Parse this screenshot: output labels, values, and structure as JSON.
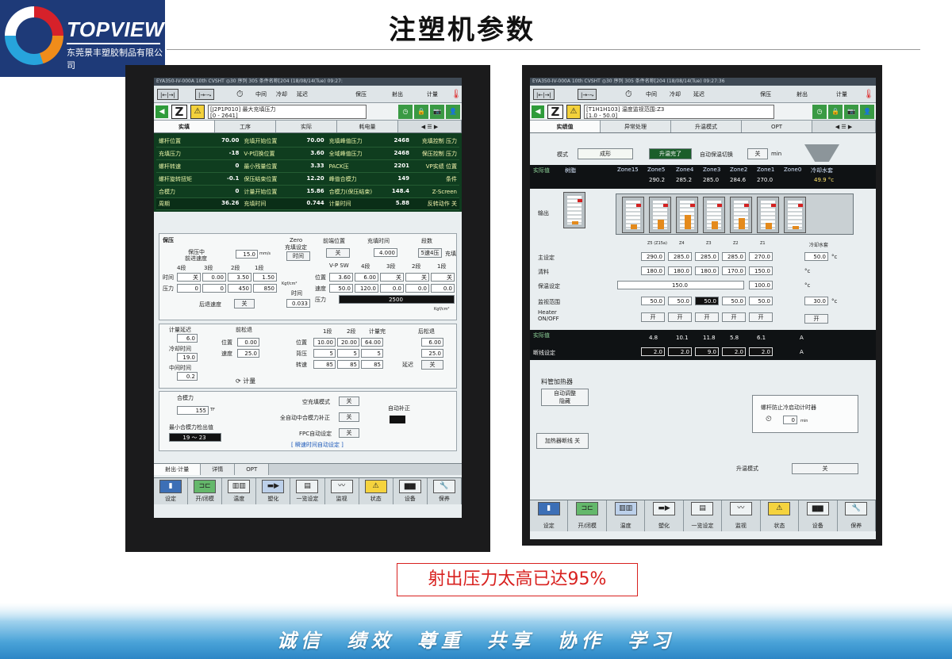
{
  "header": {
    "brand": "TOPVIEW",
    "company": "东莞景丰塑胶制品有限公司",
    "title": "注塑机参数"
  },
  "caption": "射出压力太高已达95%",
  "slogan": "诚信 绩效 尊重 共享 协作 学习",
  "left_screen": {
    "status": "EYA350-IV-000A 10th CVSHT  ◎30 序列 305 条件名称[204   (18/08/14(Tue)  09:27:",
    "top": {
      "inj_label": "射出",
      "hold_label": "保压",
      "meter_label": "计量",
      "stage1": "中间",
      "stage2": "冷却",
      "stage3": "延迟"
    },
    "param_code": "[J2P1P010] 最大充填压力",
    "param_range": "[0 - 2641]",
    "tabs": [
      "实填",
      "工序",
      "实际",
      "耗电量"
    ],
    "data_rows": [
      [
        [
          "螺杆位置",
          "70.00"
        ],
        [
          "充填开始位置",
          "70.00"
        ],
        [
          "充填峰值压力",
          "2468"
        ]
      ],
      [
        [
          "充填压力",
          "-18"
        ],
        [
          "V-P切换位置",
          "3.60"
        ],
        [
          "全域峰值压力",
          "2468"
        ]
      ],
      [
        [
          "螺杆转速",
          "0"
        ],
        [
          "最小残量位置",
          "3.33"
        ],
        [
          "PACK压",
          "2201"
        ]
      ],
      [
        [
          "螺杆旋转扭矩",
          "-0.1"
        ],
        [
          "保压结束位置",
          "12.20"
        ],
        [
          "峰值合模力",
          "149"
        ]
      ],
      [
        [
          "合模力",
          "0"
        ],
        [
          "计量开始位置",
          "15.86"
        ],
        [
          "合模力(保压结束)",
          "148.4"
        ]
      ]
    ],
    "side_labels": [
      [
        "压力",
        "充填控制"
      ],
      [
        "压力",
        "保压控制"
      ],
      [
        "位置",
        "VP实绩"
      ],
      [
        "条件",
        ""
      ],
      [
        "Z-Screen",
        ""
      ],
      [
        "反转动作",
        ""
      ]
    ],
    "summary": {
      "cycle_label": "周期",
      "cycle_val": "36.26",
      "fill_label": "充填时间",
      "fill_val": "0.744",
      "meter_label": "计量时间",
      "meter_val": "5.88",
      "side": "关"
    },
    "hold": {
      "title": "保压",
      "zero_label": "Zero",
      "zero_setting": "充填设定",
      "zero_btn": "时间",
      "speed_label": "保压中",
      "speed_sub": "前进速度",
      "speed_val": "15.0",
      "speed_unit": "mm/s",
      "stages": [
        "4段",
        "3段",
        "2段",
        "1段"
      ],
      "time_label": "时间",
      "time_vals": [
        "关",
        "0.00",
        "3.50",
        "1.50"
      ],
      "press_label": "压力",
      "press_vals": [
        "0",
        "0",
        "450",
        "850"
      ],
      "back_label": "后退速度",
      "back_val": "关",
      "time2_label": "时间",
      "time2_val": "0.033",
      "unit_kgf": "Kgf/cm²"
    },
    "fill": {
      "front_label": "前端位置",
      "front_val": "关",
      "filltime_label": "充填时间",
      "filltime_val": "4.000",
      "stage_label": "段数",
      "stage_val": "5速4压",
      "fill_label": "充填",
      "vp_label": "V-P SW",
      "stages": [
        "4段",
        "3段",
        "2段",
        "1段"
      ],
      "pos_label": "位置",
      "pos_vals": [
        "3.60",
        "6.00",
        "关",
        "关",
        "关"
      ],
      "speed_label": "速度",
      "speed_vals": [
        "50.0",
        "120.0",
        "0.0",
        "0.0",
        "0.0"
      ],
      "press_label": "压力",
      "press_val": "2500",
      "unit_kgf": "Kgf/cm²"
    },
    "meter": {
      "delay_label": "计量延迟",
      "delay_val": "6.0",
      "cool_label": "冷却时间",
      "cool_val": "19.0",
      "mid_label": "中间时间",
      "mid_val": "0.2",
      "pre_label": "前松退",
      "pos_label": "位置",
      "pos_val": "0.00",
      "spd_label": "速度",
      "spd_val": "25.0",
      "stages": [
        "1段",
        "2段",
        "计量完"
      ],
      "mpos_label": "位置",
      "mpos_vals": [
        "10.00",
        "20.00",
        "64.00"
      ],
      "back_label": "背压",
      "back_vals": [
        "5",
        "5",
        "5"
      ],
      "rpm_label": "转速",
      "rpm_vals": [
        "85",
        "85",
        "85"
      ],
      "post_label": "后松退",
      "post_pos": "6.00",
      "post_spd": "25.0",
      "delay2_label": "延迟",
      "delay2_val": "关",
      "title": "计量"
    },
    "clamp": {
      "title": "合模力",
      "val": "155",
      "unit": "TF",
      "min_label": "最小合模力检出值",
      "min_val": "19 ～  23",
      "empty_label": "空充填模式",
      "empty_val": "关",
      "auto_label": "全自动中合模力补正",
      "auto_val": "关",
      "fpc_label": "FPC自动设定",
      "fpc_val": "关",
      "link": "[ 瞬速时间自动设定 ]",
      "auto_corr": "自动补正"
    },
    "bottom_tabs": [
      "射出·计量",
      "详情",
      "OPT"
    ],
    "func": [
      "设定",
      "开/闭模",
      "温度",
      "塑化",
      "一览设定",
      "监视",
      "状态",
      "设备",
      "保养"
    ]
  },
  "right_screen": {
    "status": "EYA350-IV-000A 10th CVSHT  ◎30 序列 305 条件名称[204   (18/08/14(Tue)  09:27:36",
    "param_code": "[T1H1H103] 温度监视范围:Z3",
    "param_range": "[1.0 - 50.0]",
    "tabs": [
      "实绩值",
      "异常处理",
      "升温模式",
      "OPT"
    ],
    "mode_label": "模式",
    "mode_val": "成形",
    "heat_done": "升温完了",
    "auto_keep": "自动保温切换",
    "auto_keep_val": "关",
    "min_label": "min",
    "actual_label": "实际值",
    "resin_label": "树脂",
    "zones": [
      "Zone15",
      "Zone5",
      "Zone4",
      "Zone3",
      "Zone2",
      "Zone1",
      "Zone0",
      "冷却水套"
    ],
    "zone_vals": [
      "290.2",
      "285.2",
      "285.0",
      "284.6",
      "270.0",
      "49.9 °c"
    ],
    "output_label": "输出",
    "table_hdr": [
      "Z5 (Z15a)",
      "Z4",
      "Z3",
      "Z2",
      "Z1",
      "冷却水套"
    ],
    "set_label": "主设定",
    "set_vals": [
      "290.0",
      "285.0",
      "285.0",
      "285.0",
      "270.0"
    ],
    "set_cool": "50.0",
    "clean_label": "清料",
    "clean_vals": [
      "180.0",
      "180.0",
      "180.0",
      "170.0",
      "150.0"
    ],
    "keep_label": "保温设定",
    "keep_a": "150.0",
    "keep_b": "100.0",
    "range_label": "监视范围",
    "range_vals": [
      "50.0",
      "50.0",
      "50.0",
      "50.0",
      "50.0"
    ],
    "range_cool": "30.0",
    "heater_label": "Heater ON/OFF",
    "heater_vals": [
      "开",
      "开",
      "开",
      "开",
      "开"
    ],
    "heater_cool": "开",
    "unit_c": "°c",
    "act2_label": "实际值",
    "act2_vals": [
      "4.8",
      "10.1",
      "11.8",
      "5.8",
      "6.1"
    ],
    "unit_a": "A",
    "break_label": "断线设定",
    "break_vals": [
      "2.0",
      "2.0",
      "9.0",
      "2.0",
      "2.0"
    ],
    "feed_label": "料管加热器",
    "auto_adj": "自动调整",
    "auto_adj2": "隐藏",
    "heater_break": "加热器断线",
    "heater_break_val": "关",
    "screw_timer": "螺杆防止冷启动计时器",
    "timer_val": "0",
    "timer_unit": "min",
    "heat_mode": "升温模式",
    "heat_mode_val": "关",
    "func": [
      "设定",
      "开/闭模",
      "温度",
      "塑化",
      "一览设定",
      "监视",
      "状态",
      "设备",
      "保养"
    ]
  }
}
